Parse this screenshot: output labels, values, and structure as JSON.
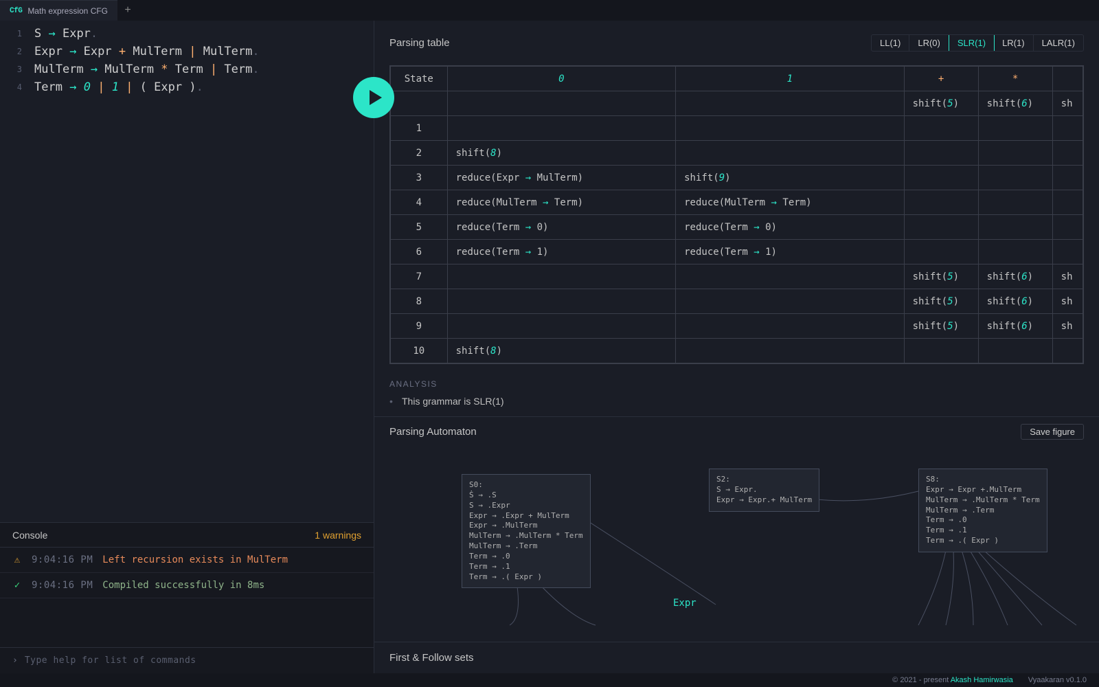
{
  "tab": {
    "icon": "CfG",
    "label": "Math expression CFG"
  },
  "editor": {
    "lines": [
      {
        "n": "1",
        "raw": "S → Expr."
      },
      {
        "n": "2",
        "raw": "Expr → Expr + MulTerm | MulTerm."
      },
      {
        "n": "3",
        "raw": "MulTerm → MulTerm * Term | Term."
      },
      {
        "n": "4",
        "raw": "Term → 0 | 1 | ( Expr )."
      }
    ]
  },
  "parsing_table": {
    "title": "Parsing table",
    "tabs": [
      "LL(1)",
      "LR(0)",
      "SLR(1)",
      "LR(1)",
      "LALR(1)"
    ],
    "active_tab": "SLR(1)",
    "columns": [
      "State",
      "0",
      "1",
      "+",
      "*"
    ],
    "rows": [
      {
        "state": "",
        "c0": "",
        "c1": "",
        "c2": "shift(5)",
        "c3": "shift(6)"
      },
      {
        "state": "1",
        "c0": "",
        "c1": "",
        "c2": "",
        "c3": ""
      },
      {
        "state": "2",
        "c0": "shift(8)",
        "c1": "",
        "c2": "",
        "c3": ""
      },
      {
        "state": "3",
        "c0": "reduce(Expr → MulTerm)",
        "c1": "shift(9)",
        "c2": "",
        "c3": ""
      },
      {
        "state": "4",
        "c0": "reduce(MulTerm → Term)",
        "c1": "reduce(MulTerm → Term)",
        "c2": "",
        "c3": ""
      },
      {
        "state": "5",
        "c0": "reduce(Term → 0)",
        "c1": "reduce(Term → 0)",
        "c2": "",
        "c3": ""
      },
      {
        "state": "6",
        "c0": "reduce(Term → 1)",
        "c1": "reduce(Term → 1)",
        "c2": "",
        "c3": ""
      },
      {
        "state": "7",
        "c0": "",
        "c1": "",
        "c2": "shift(5)",
        "c3": "shift(6)"
      },
      {
        "state": "8",
        "c0": "",
        "c1": "",
        "c2": "shift(5)",
        "c3": "shift(6)"
      },
      {
        "state": "9",
        "c0": "",
        "c1": "",
        "c2": "shift(5)",
        "c3": "shift(6)"
      },
      {
        "state": "10",
        "c0": "shift(8)",
        "c1": "",
        "c2": "",
        "c3": ""
      }
    ],
    "overflow_hint": "sh"
  },
  "analysis": {
    "label": "ANALYSIS",
    "items": [
      "This grammar is SLR(1)"
    ]
  },
  "automaton": {
    "title": "Parsing Automaton",
    "save_label": "Save figure",
    "edge_label": "Expr",
    "nodes": {
      "s0": "S0:\nṠ → .S\nS → .Expr\nExpr → .Expr + MulTerm\nExpr → .MulTerm\nMulTerm → .MulTerm * Term\nMulTerm → .Term\nTerm → .0\nTerm → .1\nTerm → .( Expr )",
      "s2": "S2:\nS → Expr.\nExpr → Expr.+ MulTerm",
      "s8": "S8:\nExpr → Expr +.MulTerm\nMulTerm → .MulTerm * Term\nMulTerm → .Term\nTerm → .0\nTerm → .1\nTerm → .( Expr )"
    }
  },
  "ff_sets": {
    "title": "First & Follow sets"
  },
  "console": {
    "title": "Console",
    "badge": "1 warnings",
    "rows": [
      {
        "icon": "warn",
        "time": "9:04:16 PM",
        "msg": "Left recursion exists in MulTerm",
        "cls": "warn"
      },
      {
        "icon": "ok",
        "time": "9:04:16 PM",
        "msg": "Compiled successfully in 8ms",
        "cls": "ok"
      }
    ],
    "placeholder": "Type help for list of commands"
  },
  "footer": {
    "copyright": "© 2021 - present ",
    "author": "Akash Hamirwasia",
    "version": "Vyaakaran v0.1.0"
  }
}
